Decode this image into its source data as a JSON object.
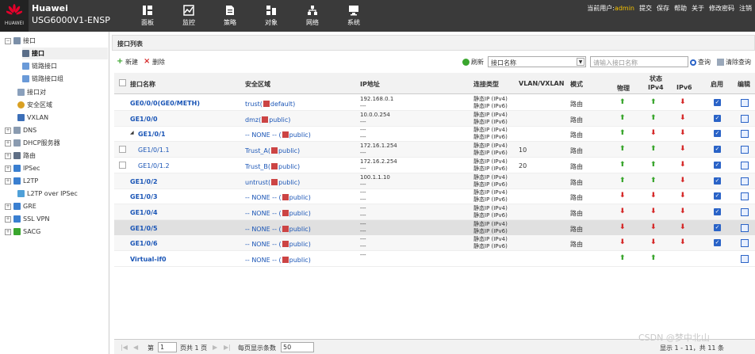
{
  "header": {
    "brand": "HUAWEI",
    "product_line1": "Huawei",
    "product_line2": "USG6000V1-ENSP",
    "nav": [
      {
        "label": "面板",
        "icon": "dashboard-icon"
      },
      {
        "label": "监控",
        "icon": "monitor-icon"
      },
      {
        "label": "策略",
        "icon": "policy-icon"
      },
      {
        "label": "对象",
        "icon": "object-icon"
      },
      {
        "label": "网络",
        "icon": "network-icon"
      },
      {
        "label": "系统",
        "icon": "system-icon"
      }
    ],
    "user_prefix": "当前用户:",
    "user_name": "admin",
    "links": [
      "提交",
      "保存",
      "帮助",
      "关于",
      "修改密码",
      "注销"
    ]
  },
  "sidebar": {
    "items": [
      {
        "label": "接口",
        "icon": "interface-icon"
      },
      {
        "label": "接口",
        "icon": "interface-icon"
      },
      {
        "label": "链路接口",
        "icon": "link-icon"
      },
      {
        "label": "链路接口组",
        "icon": "link-group-icon"
      },
      {
        "label": "接口对",
        "icon": "interface-pair-icon"
      },
      {
        "label": "安全区域",
        "icon": "security-zone-icon"
      },
      {
        "label": "VXLAN",
        "icon": "vxlan-icon"
      },
      {
        "label": "DNS",
        "icon": "dns-icon"
      },
      {
        "label": "DHCP服务器",
        "icon": "dhcp-icon"
      },
      {
        "label": "路由",
        "icon": "route-icon"
      },
      {
        "label": "IPSec",
        "icon": "ipsec-icon"
      },
      {
        "label": "L2TP",
        "icon": "l2tp-icon"
      },
      {
        "label": "L2TP over IPSec",
        "icon": "l2tp-ipsec-icon"
      },
      {
        "label": "GRE",
        "icon": "gre-icon"
      },
      {
        "label": "SSL VPN",
        "icon": "sslvpn-icon"
      },
      {
        "label": "SACG",
        "icon": "sacg-icon"
      }
    ]
  },
  "main": {
    "title": "接口列表",
    "toolbar": {
      "add": "新建",
      "delete": "删除",
      "refresh": "刷新",
      "select_value": "接口名称",
      "search_placeholder": "请输入接口名称",
      "query": "查询",
      "clear": "清除查询"
    },
    "columns": {
      "name": "接口名称",
      "zone": "安全区域",
      "ip": "IP地址",
      "conn": "连接类型",
      "vlan": "VLAN/VXLAN",
      "mode": "模式",
      "status": "状态",
      "phys": "物理",
      "ipv4": "IPv4",
      "ipv6": "IPv6",
      "enable": "启用",
      "edit": "编辑"
    },
    "rows": [
      {
        "name": "GE0/0/0(GE0/METH)",
        "zone": "trust(",
        "vsys": "default)",
        "ip1": "192.168.0.1",
        "ip2": "---",
        "c1": "静态IP (IPv4)",
        "c2": "静态IP (IPv6)",
        "vlan": "",
        "mode": "路由",
        "phys": "up",
        "v4": "up",
        "v6": "down",
        "enabled": true
      },
      {
        "name": "GE1/0/0",
        "zone": "dmz(",
        "vsys": "public)",
        "ip1": "10.0.0.254",
        "ip2": "---",
        "c1": "静态IP (IPv4)",
        "c2": "静态IP (IPv6)",
        "vlan": "",
        "mode": "路由",
        "phys": "up",
        "v4": "up",
        "v6": "down",
        "enabled": true
      },
      {
        "name": "GE1/0/1",
        "zone": "-- NONE -- (",
        "vsys": "public)",
        "ip1": "---",
        "ip2": "---",
        "c1": "静态IP (IPv4)",
        "c2": "静态IP (IPv6)",
        "vlan": "",
        "mode": "路由",
        "phys": "up",
        "v4": "down",
        "v6": "down",
        "enabled": true
      },
      {
        "name": "GE1/0/1.1",
        "zone": "Trust_A(",
        "vsys": "public)",
        "ip1": "172.16.1.254",
        "ip2": "---",
        "c1": "静态IP (IPv4)",
        "c2": "静态IP (IPv6)",
        "vlan": "10",
        "mode": "路由",
        "phys": "up",
        "v4": "up",
        "v6": "down",
        "enabled": true
      },
      {
        "name": "GE1/0/1.2",
        "zone": "Trust_B(",
        "vsys": "public)",
        "ip1": "172.16.2.254",
        "ip2": "---",
        "c1": "静态IP (IPv4)",
        "c2": "静态IP (IPv6)",
        "vlan": "20",
        "mode": "路由",
        "phys": "up",
        "v4": "up",
        "v6": "down",
        "enabled": true
      },
      {
        "name": "GE1/0/2",
        "zone": "untrust(",
        "vsys": "public)",
        "ip1": "100.1.1.10",
        "ip2": "---",
        "c1": "静态IP (IPv4)",
        "c2": "静态IP (IPv6)",
        "vlan": "",
        "mode": "路由",
        "phys": "up",
        "v4": "up",
        "v6": "down",
        "enabled": true
      },
      {
        "name": "GE1/0/3",
        "zone": "-- NONE -- (",
        "vsys": "public)",
        "ip1": "---",
        "ip2": "---",
        "c1": "静态IP (IPv4)",
        "c2": "静态IP (IPv6)",
        "vlan": "",
        "mode": "路由",
        "phys": "down",
        "v4": "down",
        "v6": "down",
        "enabled": true
      },
      {
        "name": "GE1/0/4",
        "zone": "-- NONE -- (",
        "vsys": "public)",
        "ip1": "---",
        "ip2": "---",
        "c1": "静态IP (IPv4)",
        "c2": "静态IP (IPv6)",
        "vlan": "",
        "mode": "路由",
        "phys": "down",
        "v4": "down",
        "v6": "down",
        "enabled": true
      },
      {
        "name": "GE1/0/5",
        "zone": "-- NONE -- (",
        "vsys": "public)",
        "ip1": "---",
        "ip2": "---",
        "c1": "静态IP (IPv4)",
        "c2": "静态IP (IPv6)",
        "vlan": "",
        "mode": "路由",
        "phys": "down",
        "v4": "down",
        "v6": "down",
        "enabled": true
      },
      {
        "name": "GE1/0/6",
        "zone": "-- NONE -- (",
        "vsys": "public)",
        "ip1": "---",
        "ip2": "---",
        "c1": "静态IP (IPv4)",
        "c2": "静态IP (IPv6)",
        "vlan": "",
        "mode": "路由",
        "phys": "down",
        "v4": "down",
        "v6": "down",
        "enabled": true
      },
      {
        "name": "Virtual-if0",
        "zone": "-- NONE -- (",
        "vsys": "public)",
        "ip1": "---",
        "ip2": "",
        "c1": "",
        "c2": "",
        "vlan": "",
        "mode": "",
        "phys": "up",
        "v4": "up",
        "v6": "",
        "enabled": false
      }
    ],
    "pager": {
      "page_prefix": "第",
      "page": "1",
      "page_suffix": "页共 1 页",
      "per_page_label": "每页显示条数",
      "per_page": "50",
      "summary": "显示 1 - 11，共 11 条"
    }
  },
  "watermark": "CSDN @梦中北山",
  "colors": {
    "topbar": "#3a3a3a",
    "up_arrow": "#3aa62e",
    "down_arrow": "#d52828",
    "link": "#1a55b6",
    "user": "#f5c000"
  }
}
